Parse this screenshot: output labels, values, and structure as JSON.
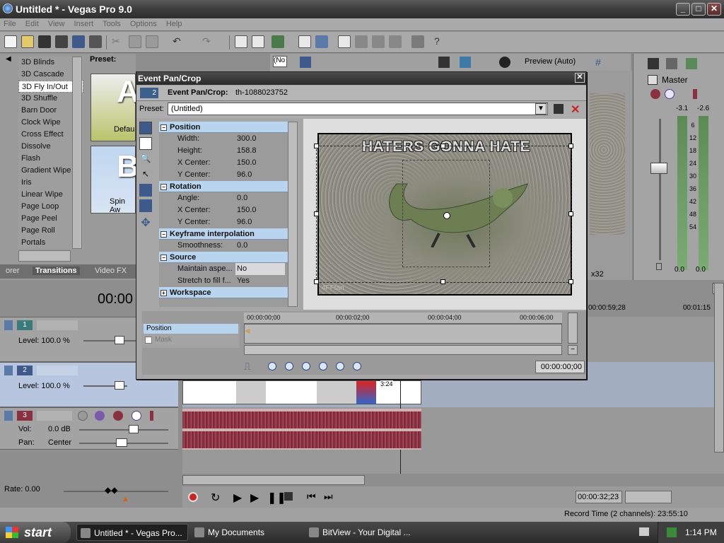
{
  "window": {
    "title": "Untitled * - Vegas Pro 9.0",
    "min": "_",
    "max": "□",
    "close": "✕"
  },
  "menu": [
    "File",
    "Edit",
    "View",
    "Insert",
    "Tools",
    "Options",
    "Help"
  ],
  "transitions": {
    "preset_label": "Preset:",
    "items": [
      "3D Blinds",
      "3D Cascade",
      "3D Fly In/Out",
      "3D Shuffle",
      "Barn Door",
      "Clock Wipe",
      "Cross Effect",
      "Dissolve",
      "Flash",
      "Gradient Wipe",
      "Iris",
      "Linear Wipe",
      "Page Loop",
      "Page Peel",
      "Page Roll",
      "Portals"
    ],
    "selected_index": 2,
    "thumb1_letter": "A",
    "thumb1_label": "Defau",
    "thumb2_letter": "B",
    "thumb2_label": "Spin Aw"
  },
  "tabs": [
    "orer",
    "Transitions",
    "Video FX"
  ],
  "preview": {
    "quality": "Preview (Auto)",
    "field": "(No",
    "zoom": "x32"
  },
  "mixer": {
    "label": "Master",
    "peak_left": "-3.1",
    "peak_right": "-2.6",
    "scale": [
      "6",
      "12",
      "18",
      "24",
      "30",
      "36",
      "42",
      "48",
      "54"
    ],
    "bottom_left": "0.0",
    "bottom_right": "0.0"
  },
  "timeline": {
    "cursor": "00:00",
    "ruler": [
      "00:00:59;28",
      "00:01:15"
    ],
    "end_time": "00:00:32;23",
    "rate_label": "Rate: 0.00",
    "record_time": "Record Time (2 channels): 23:55:10"
  },
  "tracks": [
    {
      "num": "1",
      "level": "Level: 100.0 %",
      "color": "#3a7a7a"
    },
    {
      "num": "2",
      "level": "Level: 100.0 %",
      "color": "#3d5a8a"
    },
    {
      "num": "3",
      "vol_label": "Vol:",
      "vol": "0.0 dB",
      "pan_label": "Pan:",
      "pan": "Center",
      "color": "#8a3040"
    }
  ],
  "clip_label": "3:24",
  "dialog": {
    "title": "Event Pan/Crop",
    "close": "✕",
    "head_num": "2",
    "head_label": "Event Pan/Crop:",
    "head_value": "th-1088023752",
    "preset_label": "Preset:",
    "preset_value": "(Untitled)",
    "groups": [
      {
        "name": "Position",
        "rows": [
          [
            "Width:",
            "300.0"
          ],
          [
            "Height:",
            "158.8"
          ],
          [
            "X Center:",
            "150.0"
          ],
          [
            "Y Center:",
            "96.0"
          ]
        ]
      },
      {
        "name": "Rotation",
        "rows": [
          [
            "Angle:",
            "0.0"
          ],
          [
            "X Center:",
            "150.0"
          ],
          [
            "Y Center:",
            "96.0"
          ]
        ]
      },
      {
        "name": "Keyframe interpolation",
        "rows": [
          [
            "Smoothness:",
            "0.0"
          ]
        ]
      },
      {
        "name": "Source",
        "rows": [
          [
            "Maintain aspe...",
            "No"
          ],
          [
            "Stretch to fill f...",
            "Yes"
          ]
        ]
      },
      {
        "name": "Workspace",
        "rows": []
      }
    ],
    "meme_text": "HATERS GONNA HATE",
    "watermark": "4FFtan",
    "kf_ruler": [
      "00:00:00;00",
      "00:00:02;00",
      "00:00:04;00",
      "00:00:06;00"
    ],
    "kf_position": "Position",
    "kf_mask": "Mask",
    "kf_time": "00:00:00;00"
  },
  "taskbar": {
    "start": "start",
    "items": [
      "Untitled * - Vegas Pro...",
      "My Documents",
      "BitView - Your Digital ..."
    ],
    "clock": "1:14 PM"
  }
}
